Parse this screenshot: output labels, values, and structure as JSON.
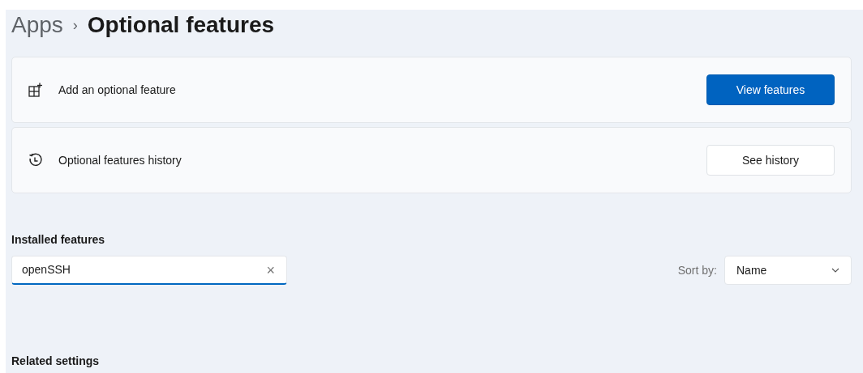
{
  "breadcrumb": {
    "parent": "Apps",
    "separator": "›",
    "current": "Optional features"
  },
  "cards": [
    {
      "kind": "add",
      "label": "Add an optional feature",
      "button": {
        "label": "View features",
        "primary": true
      }
    },
    {
      "kind": "history",
      "label": "Optional features history",
      "button": {
        "label": "See history",
        "primary": false
      }
    }
  ],
  "installed": {
    "heading": "Installed features",
    "search": {
      "value": "openSSH",
      "focused": true,
      "clear": "×"
    },
    "sort_label": "Sort by:",
    "sort_value": "Name"
  },
  "related_heading": "Related settings"
}
